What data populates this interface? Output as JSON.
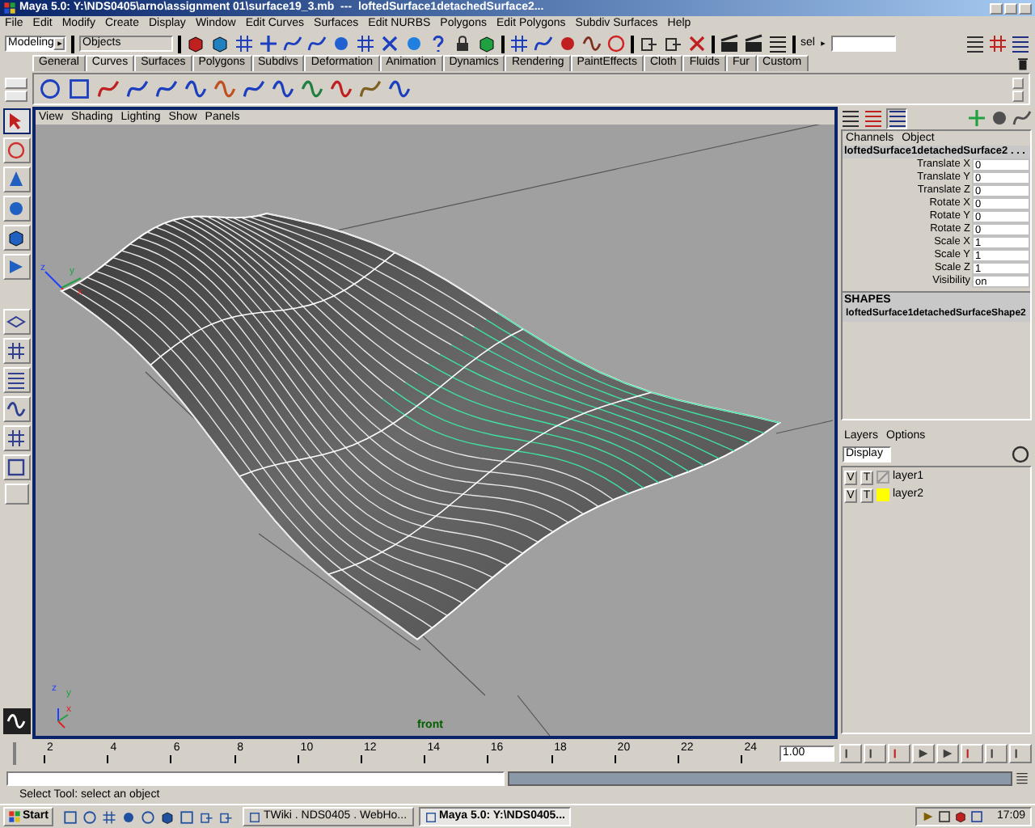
{
  "window": {
    "title": "Maya 5.0: Y:\\NDS0405\\arno\\assignment 01\\surface19_3.mb  ---  loftedSurface1detachedSurface2..."
  },
  "menu_bar": [
    "File",
    "Edit",
    "Modify",
    "Create",
    "Display",
    "Window",
    "Edit Curves",
    "Surfaces",
    "Edit NURBS",
    "Polygons",
    "Edit Polygons",
    "Subdiv Surfaces",
    "Help"
  ],
  "status_line": {
    "menu_set": "Modeling",
    "selection_mask": "Objects",
    "quick_select_label": "sel"
  },
  "shelf_tabs": [
    {
      "label": "General",
      "selected": false
    },
    {
      "label": "Curves",
      "selected": true
    },
    {
      "label": "Surfaces",
      "selected": false
    },
    {
      "label": "Polygons",
      "selected": false
    },
    {
      "label": "Subdivs",
      "selected": false
    },
    {
      "label": "Deformation",
      "selected": false
    },
    {
      "label": "Animation",
      "selected": false
    },
    {
      "label": "Dynamics",
      "selected": false
    },
    {
      "label": "Rendering",
      "selected": false
    },
    {
      "label": "PaintEffects",
      "selected": false
    },
    {
      "label": "Cloth",
      "selected": false
    },
    {
      "label": "Fluids",
      "selected": false
    },
    {
      "label": "Fur",
      "selected": false
    },
    {
      "label": "Custom",
      "selected": false
    }
  ],
  "viewport": {
    "menu": [
      "View",
      "Shading",
      "Lighting",
      "Show",
      "Panels"
    ],
    "camera_label": "front",
    "origin_axes": [
      "z",
      "y",
      "x"
    ],
    "corner_axes": [
      "z",
      "y",
      "x"
    ]
  },
  "channel_box": {
    "menu": [
      "Channels",
      "Object"
    ],
    "object": "loftedSurface1detachedSurface2 . . .",
    "channels": [
      {
        "name": "Translate X",
        "value": "0"
      },
      {
        "name": "Translate Y",
        "value": "0"
      },
      {
        "name": "Translate Z",
        "value": "0"
      },
      {
        "name": "Rotate X",
        "value": "0"
      },
      {
        "name": "Rotate Y",
        "value": "0"
      },
      {
        "name": "Rotate Z",
        "value": "0"
      },
      {
        "name": "Scale X",
        "value": "1"
      },
      {
        "name": "Scale Y",
        "value": "1"
      },
      {
        "name": "Scale Z",
        "value": "1"
      },
      {
        "name": "Visibility",
        "value": "on"
      }
    ],
    "shapes_heading": "SHAPES",
    "shape": "loftedSurface1detachedSurfaceShape2"
  },
  "layers": {
    "menu": [
      "Layers",
      "Options"
    ],
    "display_mode": "Display",
    "items": [
      {
        "visible": "V",
        "template": "T",
        "name": "layer1"
      },
      {
        "visible": "V",
        "template": "T",
        "name": "layer2",
        "color": "#ffff00"
      }
    ]
  },
  "time_slider": {
    "level": 0,
    "ticks": [
      "2",
      "4",
      "6",
      "8",
      "10",
      "12",
      "14",
      "16",
      "18",
      "20",
      "22",
      "24"
    ],
    "current_time": "1.00"
  },
  "help_line": "Select Tool: select an object",
  "taskbar": {
    "start": "Start",
    "tasks": [
      {
        "label": "TWiki . NDS0405 . WebHo...",
        "selected": false
      },
      {
        "label": "Maya 5.0: Y:\\NDS0405...",
        "selected": true
      }
    ],
    "clock": "17:09"
  }
}
